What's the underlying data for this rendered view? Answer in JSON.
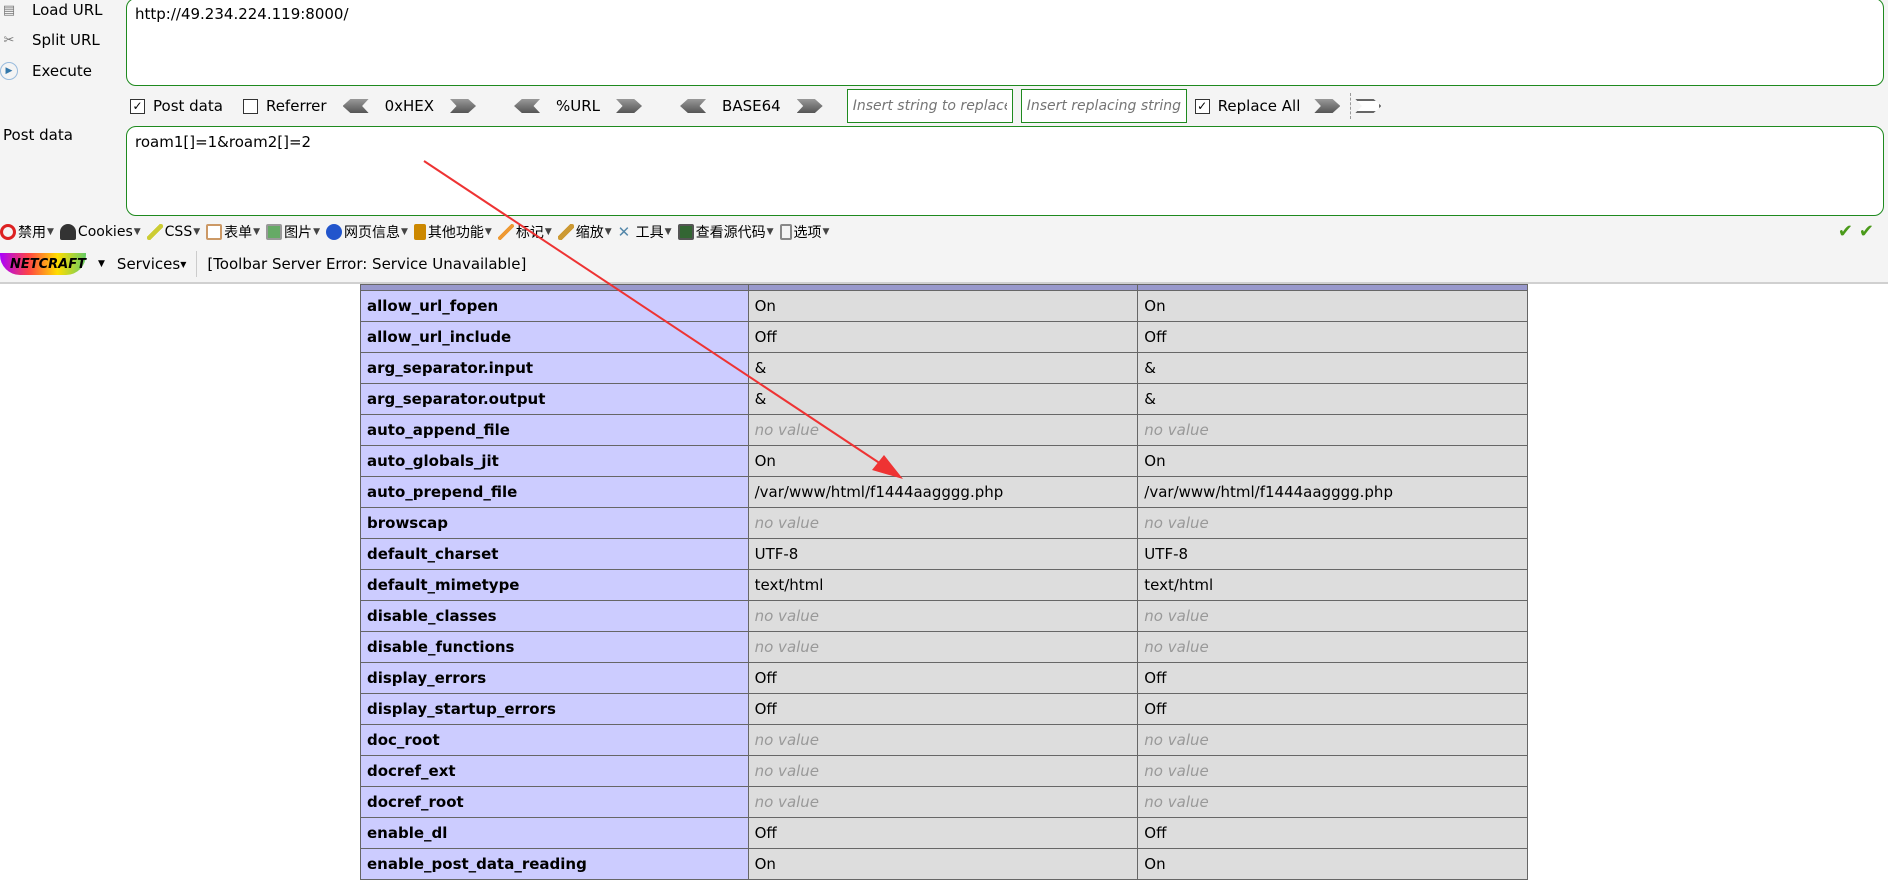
{
  "hackbar": {
    "load_url": "Load URL",
    "split_url": "Split URL",
    "execute": "Execute",
    "url_value": "http://49.234.224.119:8000/",
    "post_data_checkbox": "Post data",
    "post_data_checked": true,
    "referrer_checkbox": "Referrer",
    "referrer_checked": false,
    "hex_label": "0xHEX",
    "url_label": "%URL",
    "base64_label": "BASE64",
    "replace_from_placeholder": "Insert string to replace",
    "replace_to_placeholder": "Insert replacing string",
    "replace_all": "Replace All",
    "replace_all_checked": true,
    "post_data_label": "Post data",
    "post_data_value": "roam1[]=1&roam2[]=2"
  },
  "toolbar": {
    "items": [
      "禁用",
      "Cookies",
      "CSS",
      "表单",
      "图片",
      "网页信息",
      "其他功能",
      "标记",
      "缩放",
      "工具",
      "查看源代码",
      "选项"
    ],
    "icon_colors": [
      "#d22",
      "#333",
      "#cc3",
      "#c96",
      "#6a6",
      "#25c",
      "#c80",
      "#e93",
      "#c93",
      "#58a",
      "#363",
      "#888"
    ]
  },
  "netcraft": {
    "logo": "NETCRAFT",
    "services": "Services",
    "error": "[Toolbar Server Error: Service Unavailable]"
  },
  "table": {
    "rows": [
      [
        "allow_url_fopen",
        "On",
        "On"
      ],
      [
        "allow_url_include",
        "Off",
        "Off"
      ],
      [
        "arg_separator.input",
        "&",
        "&"
      ],
      [
        "arg_separator.output",
        "&",
        "&"
      ],
      [
        "auto_append_file",
        "no value",
        "no value"
      ],
      [
        "auto_globals_jit",
        "On",
        "On"
      ],
      [
        "auto_prepend_file",
        "/var/www/html/f1444aagggg.php",
        "/var/www/html/f1444aagggg.php"
      ],
      [
        "browscap",
        "no value",
        "no value"
      ],
      [
        "default_charset",
        "UTF-8",
        "UTF-8"
      ],
      [
        "default_mimetype",
        "text/html",
        "text/html"
      ],
      [
        "disable_classes",
        "no value",
        "no value"
      ],
      [
        "disable_functions",
        "no value",
        "no value"
      ],
      [
        "display_errors",
        "Off",
        "Off"
      ],
      [
        "display_startup_errors",
        "Off",
        "Off"
      ],
      [
        "doc_root",
        "no value",
        "no value"
      ],
      [
        "docref_ext",
        "no value",
        "no value"
      ],
      [
        "docref_root",
        "no value",
        "no value"
      ],
      [
        "enable_dl",
        "Off",
        "Off"
      ],
      [
        "enable_post_data_reading",
        "On",
        "On"
      ]
    ]
  },
  "annotation_color": "#ee3333"
}
